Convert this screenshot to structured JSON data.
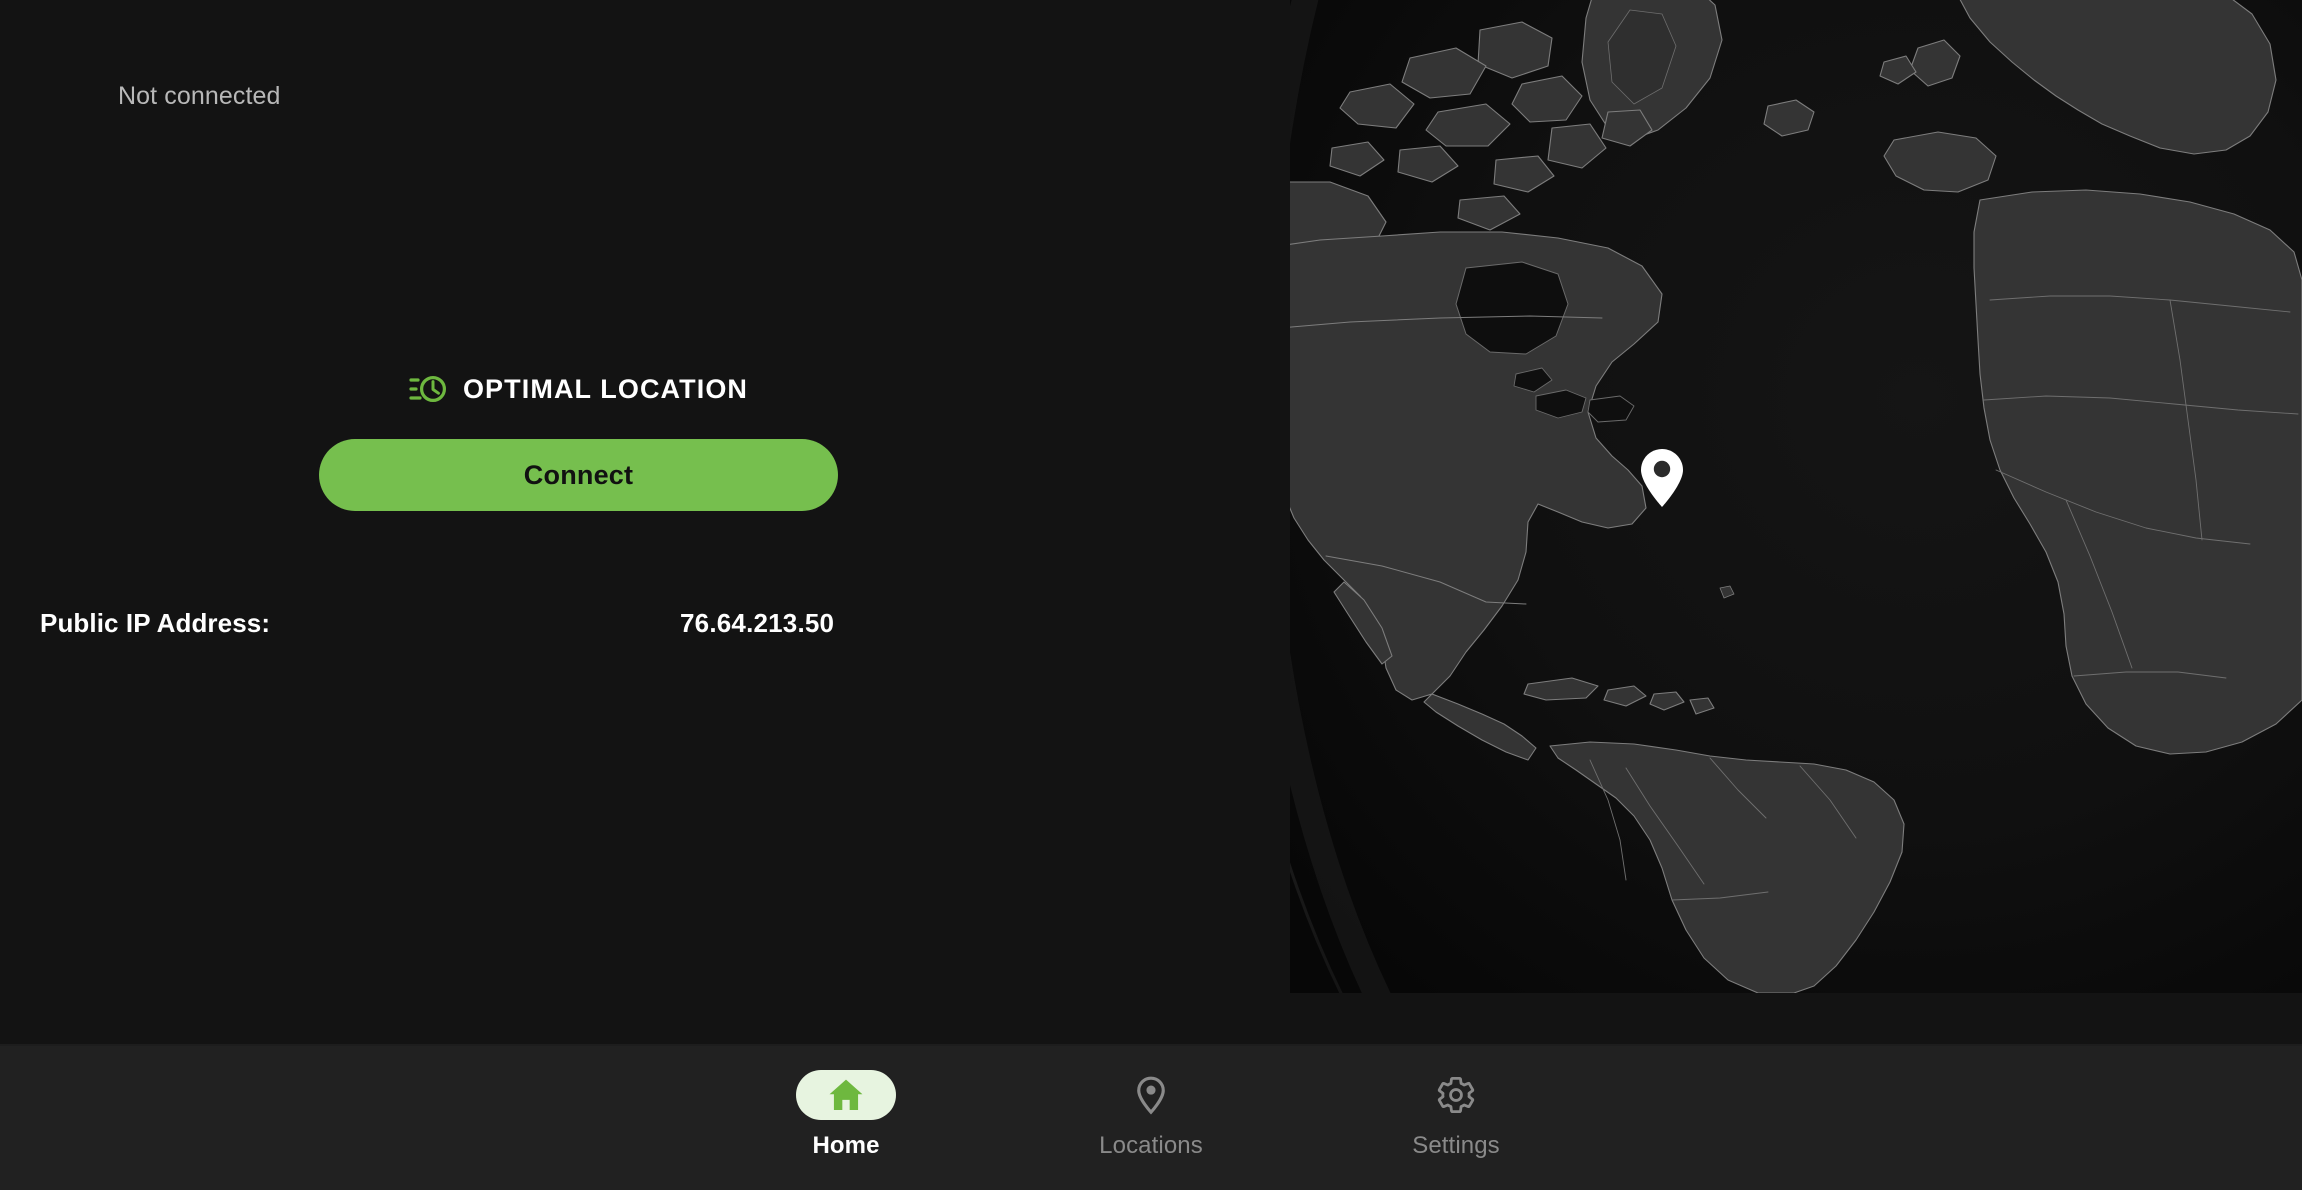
{
  "app": {
    "accent_green": "#76bf4e",
    "background": "#131313",
    "nav_background": "#212121",
    "active_pill_background": "#e7f4e0"
  },
  "status": {
    "connection_state": "Not connected"
  },
  "location_card": {
    "icon": "speed-clock-icon",
    "label": "OPTIMAL LOCATION"
  },
  "connect": {
    "label": "Connect"
  },
  "ip": {
    "label": "Public IP Address:",
    "value": "76.64.213.50"
  },
  "map": {
    "marker_icon": "map-pin-icon",
    "marker_region": "North America"
  },
  "nav": {
    "items": [
      {
        "id": "home",
        "label": "Home",
        "icon": "home-icon",
        "active": true
      },
      {
        "id": "locations",
        "label": "Locations",
        "icon": "location-pin-icon",
        "active": false
      },
      {
        "id": "settings",
        "label": "Settings",
        "icon": "gear-icon",
        "active": false
      }
    ]
  }
}
